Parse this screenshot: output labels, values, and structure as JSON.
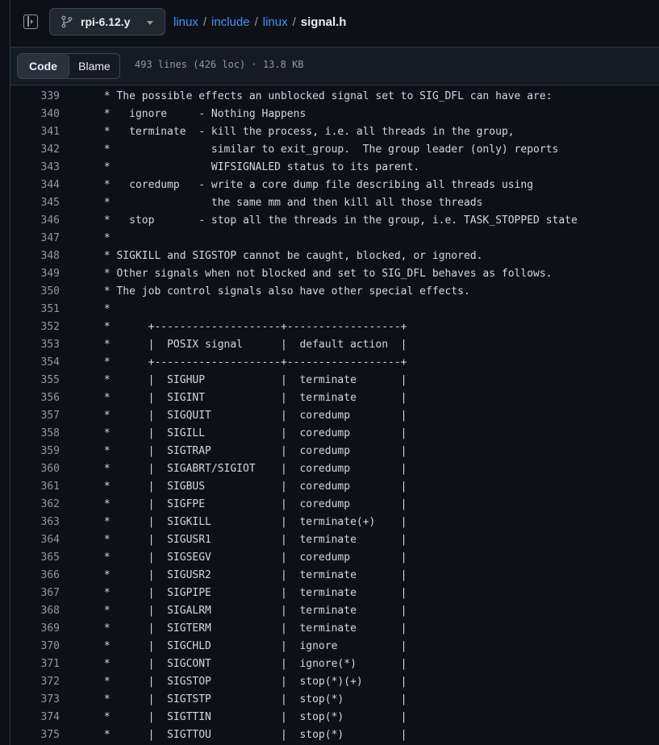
{
  "branch": {
    "name": "rpi-6.12.y"
  },
  "breadcrumb": {
    "parts": [
      "linux",
      "include",
      "linux"
    ],
    "current": "signal.h",
    "separator": "/"
  },
  "file": {
    "tabs": [
      "Code",
      "Blame"
    ],
    "active_tab": "Code",
    "meta": "493 lines (426 loc) · 13.8 KB"
  },
  "colors": {
    "background": "#0d1117",
    "link": "#4493f8",
    "muted": "#9198a1",
    "code_text": "#d1d7e0"
  },
  "code_lines": [
    {
      "num": "339",
      "text": " * The possible effects an unblocked signal set to SIG_DFL can have are:"
    },
    {
      "num": "340",
      "text": " *   ignore     - Nothing Happens"
    },
    {
      "num": "341",
      "text": " *   terminate  - kill the process, i.e. all threads in the group,"
    },
    {
      "num": "342",
      "text": " *                similar to exit_group.  The group leader (only) reports"
    },
    {
      "num": "343",
      "text": " *                WIFSIGNALED status to its parent."
    },
    {
      "num": "344",
      "text": " *   coredump   - write a core dump file describing all threads using"
    },
    {
      "num": "345",
      "text": " *                the same mm and then kill all those threads"
    },
    {
      "num": "346",
      "text": " *   stop       - stop all the threads in the group, i.e. TASK_STOPPED state"
    },
    {
      "num": "347",
      "text": " *"
    },
    {
      "num": "348",
      "text": " * SIGKILL and SIGSTOP cannot be caught, blocked, or ignored."
    },
    {
      "num": "349",
      "text": " * Other signals when not blocked and set to SIG_DFL behaves as follows."
    },
    {
      "num": "350",
      "text": " * The job control signals also have other special effects."
    },
    {
      "num": "351",
      "text": " *"
    },
    {
      "num": "352",
      "text": " *      +--------------------+------------------+"
    },
    {
      "num": "353",
      "text": " *      |  POSIX signal      |  default action  |"
    },
    {
      "num": "354",
      "text": " *      +--------------------+------------------+"
    },
    {
      "num": "355",
      "text": " *      |  SIGHUP            |  terminate       |"
    },
    {
      "num": "356",
      "text": " *      |  SIGINT            |  terminate       |"
    },
    {
      "num": "357",
      "text": " *      |  SIGQUIT           |  coredump        |"
    },
    {
      "num": "358",
      "text": " *      |  SIGILL            |  coredump        |"
    },
    {
      "num": "359",
      "text": " *      |  SIGTRAP           |  coredump        |"
    },
    {
      "num": "360",
      "text": " *      |  SIGABRT/SIGIOT    |  coredump        |"
    },
    {
      "num": "361",
      "text": " *      |  SIGBUS            |  coredump        |"
    },
    {
      "num": "362",
      "text": " *      |  SIGFPE            |  coredump        |"
    },
    {
      "num": "363",
      "text": " *      |  SIGKILL           |  terminate(+)    |"
    },
    {
      "num": "364",
      "text": " *      |  SIGUSR1           |  terminate       |"
    },
    {
      "num": "365",
      "text": " *      |  SIGSEGV           |  coredump        |"
    },
    {
      "num": "366",
      "text": " *      |  SIGUSR2           |  terminate       |"
    },
    {
      "num": "367",
      "text": " *      |  SIGPIPE           |  terminate       |"
    },
    {
      "num": "368",
      "text": " *      |  SIGALRM           |  terminate       |"
    },
    {
      "num": "369",
      "text": " *      |  SIGTERM           |  terminate       |"
    },
    {
      "num": "370",
      "text": " *      |  SIGCHLD           |  ignore          |"
    },
    {
      "num": "371",
      "text": " *      |  SIGCONT           |  ignore(*)       |"
    },
    {
      "num": "372",
      "text": " *      |  SIGSTOP           |  stop(*)(+)      |"
    },
    {
      "num": "373",
      "text": " *      |  SIGTSTP           |  stop(*)         |"
    },
    {
      "num": "374",
      "text": " *      |  SIGTTIN           |  stop(*)         |"
    },
    {
      "num": "375",
      "text": " *      |  SIGTTOU           |  stop(*)         |"
    }
  ]
}
